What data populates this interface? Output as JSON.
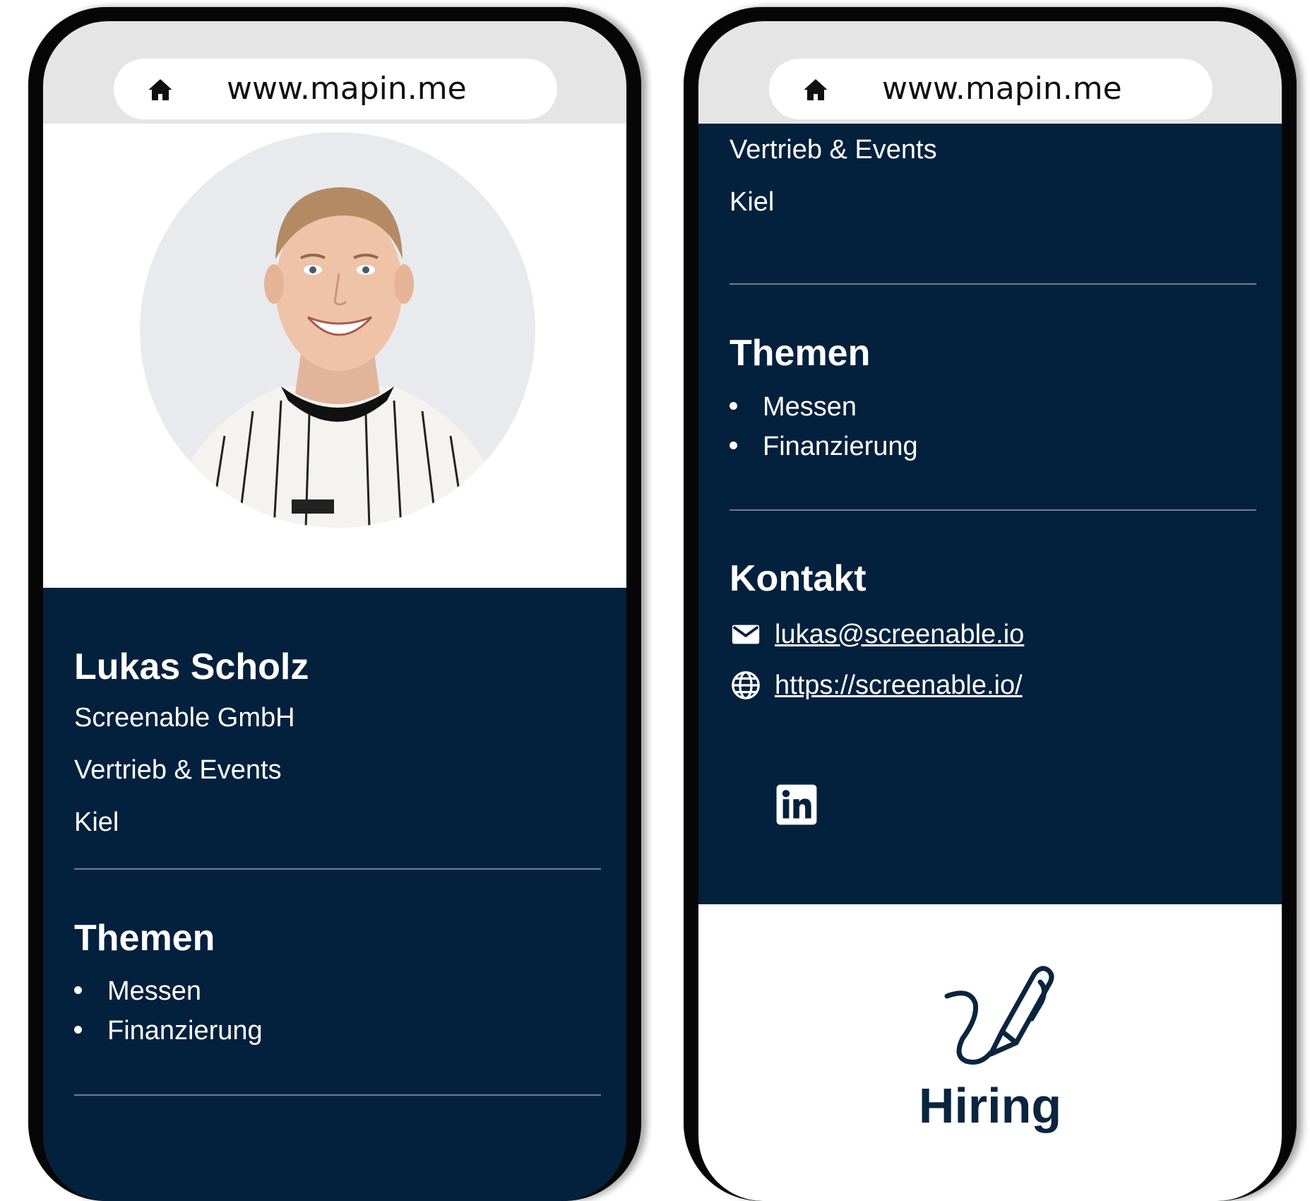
{
  "browser": {
    "url": "www.mapin.me"
  },
  "profile": {
    "name": "Lukas Scholz",
    "company": "Screenable GmbH",
    "role": "Vertrieb & Events",
    "city": "Kiel"
  },
  "topics": {
    "title": "Themen",
    "items": [
      "Messen",
      "Finanzierung"
    ]
  },
  "contact": {
    "title": "Kontakt",
    "email": "lukas@screenable.io",
    "website": "https://screenable.io/"
  },
  "social": {
    "linkedin_icon": "linkedin-icon"
  },
  "hiring": {
    "label": "Hiring"
  },
  "colors": {
    "navy": "#03203d",
    "bar": "#e5e5e5",
    "frame": "#060606"
  }
}
